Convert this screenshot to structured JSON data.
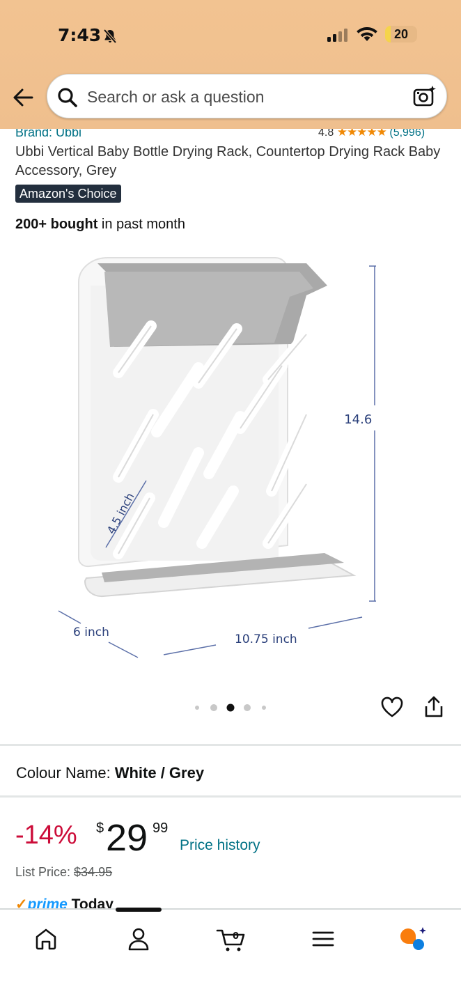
{
  "status_bar": {
    "time": "7:43",
    "battery": "20"
  },
  "search": {
    "placeholder": "Search or ask a question"
  },
  "product": {
    "brand": "Brand: Ubbi",
    "rating_value": "4.8",
    "rating_stars": "★★★★★",
    "rating_count": "(5,996)",
    "title": "Ubbi Vertical Baby Bottle Drying Rack, Countertop Drying Rack Baby Accessory, Grey",
    "badge": "Amazon's Choice",
    "bought_bold": "200+ bought",
    "bought_rest": " in past month"
  },
  "image": {
    "dim_height": "14.6 inch",
    "dim_peg": "4.5 inch",
    "dim_depth": "6 inch",
    "dim_width": "10.75 inch",
    "carousel_count": 5,
    "carousel_active": 2
  },
  "variation": {
    "label": "Colour Name:",
    "value": "White / Grey"
  },
  "pricing": {
    "discount": "-14%",
    "currency": "$",
    "whole": "29",
    "fraction": "99",
    "price_history": "Price history",
    "list_price_label": "List Price: ",
    "list_price": "$34.95"
  },
  "delivery": {
    "check": "✓",
    "prime": "prime",
    "text": " Today"
  },
  "colors": {
    "header": "#f0c18f",
    "link": "#007185",
    "discount": "#cc0c39",
    "badge": "#232f3e"
  }
}
